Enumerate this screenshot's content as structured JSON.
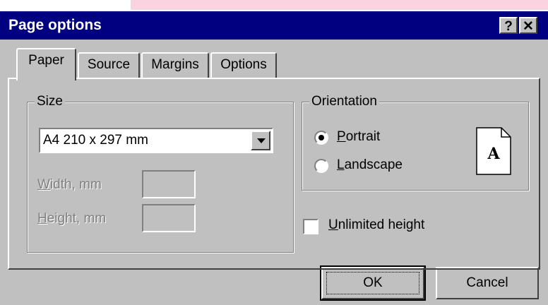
{
  "window": {
    "title": "Page options",
    "help_label": "?",
    "close_label": "✕"
  },
  "tabs": [
    {
      "label": "Paper",
      "active": true
    },
    {
      "label": "Source",
      "active": false
    },
    {
      "label": "Margins",
      "active": false
    },
    {
      "label": "Options",
      "active": false
    }
  ],
  "size_group": {
    "label": "Size",
    "selected": "A4 210 x 297 mm",
    "width_label": {
      "accel": "W",
      "rest": "idth, mm"
    },
    "height_label": {
      "accel": "H",
      "rest": "eight, mm"
    },
    "width_value": "",
    "height_value": ""
  },
  "orientation_group": {
    "label": "Orientation",
    "options": [
      {
        "accel": "P",
        "rest": "ortrait",
        "selected": true
      },
      {
        "accel": "L",
        "rest": "andscape",
        "selected": false
      }
    ],
    "preview_letter": "A"
  },
  "unlimited_height": {
    "accel": "U",
    "rest": "nlimited height",
    "checked": false
  },
  "buttons": {
    "ok": "OK",
    "cancel": "Cancel"
  }
}
